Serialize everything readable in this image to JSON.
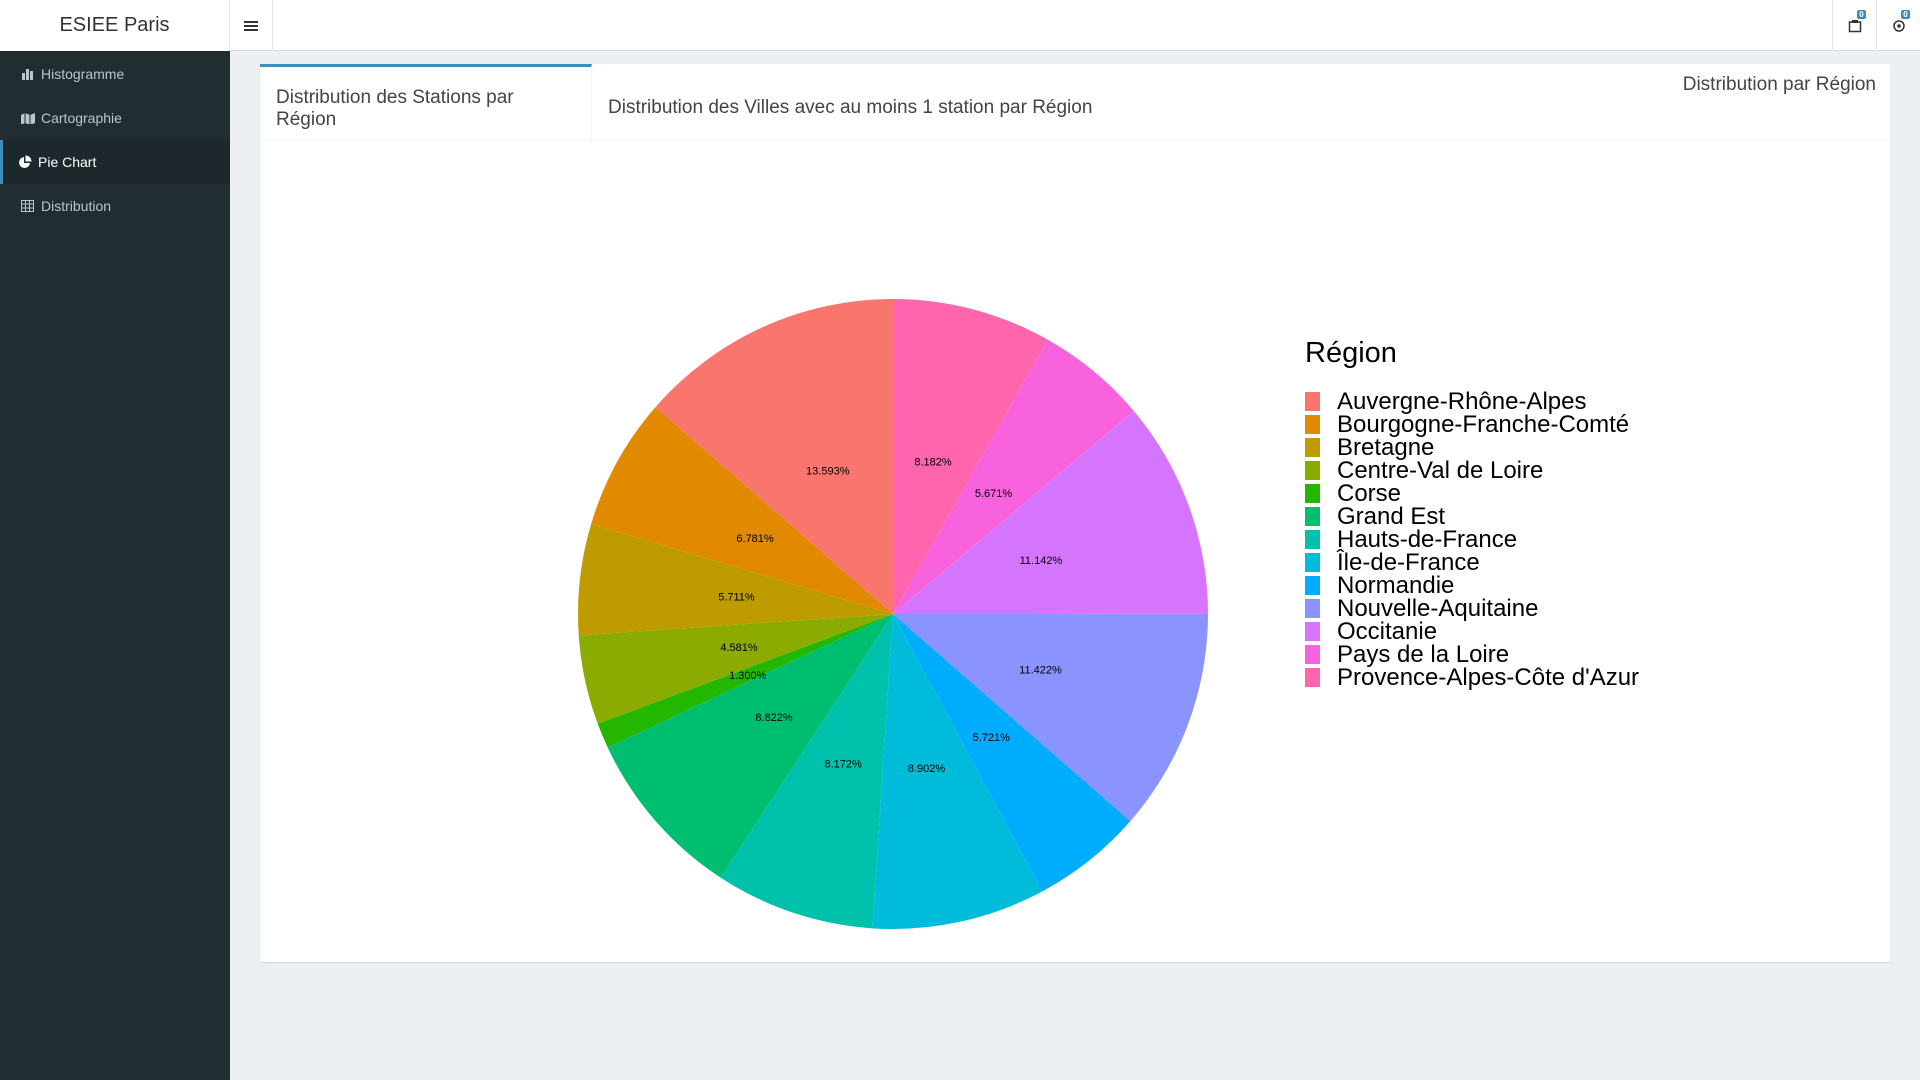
{
  "app": {
    "title": "ESIEE Paris"
  },
  "header": {
    "icons": [
      {
        "name": "tasks-icon",
        "badge": "0"
      },
      {
        "name": "gear-icon",
        "badge": "0"
      }
    ]
  },
  "sidebar": {
    "items": [
      {
        "label": "Histogramme",
        "icon": "bar-chart-icon",
        "active": false
      },
      {
        "label": "Cartographie",
        "icon": "map-icon",
        "active": false
      },
      {
        "label": "Pie Chart",
        "icon": "pie-chart-icon",
        "active": true
      },
      {
        "label": "Distribution",
        "icon": "table-icon",
        "active": false
      }
    ]
  },
  "main": {
    "box_title": "Distribution par Région",
    "tabs": [
      {
        "label": "Distribution des Stations par Région",
        "active": true
      },
      {
        "label": "Distribution des Villes avec au moins 1 station par Région",
        "active": false
      }
    ]
  },
  "chart_data": {
    "type": "pie",
    "legend_title": "Région",
    "legend_position": "right",
    "categories": [
      "Auvergne-Rhône-Alpes",
      "Bourgogne-Franche-Comté",
      "Bretagne",
      "Centre-Val de Loire",
      "Corse",
      "Grand Est",
      "Hauts-de-France",
      "Île-de-France",
      "Normandie",
      "Nouvelle-Aquitaine",
      "Occitanie",
      "Pays de la Loire",
      "Provence-Alpes-Côte d'Azur"
    ],
    "values": [
      13.593,
      6.781,
      5.711,
      4.581,
      1.3,
      8.822,
      8.172,
      8.902,
      5.721,
      11.422,
      11.142,
      5.671,
      8.182
    ],
    "labels": [
      "13.593%",
      "6.781%",
      "5.711%",
      "4.581%",
      "1.300%",
      "8.822%",
      "8.172%",
      "8.902%",
      "5.721%",
      "11.422%",
      "11.142%",
      "5.671%",
      "8.182%"
    ],
    "colors": [
      "#F8766D",
      "#E18A00",
      "#BE9C00",
      "#8CAB00",
      "#24B700",
      "#00BE70",
      "#00C1AB",
      "#00BBDA",
      "#00ACFC",
      "#8B93FF",
      "#D575FE",
      "#F962DD",
      "#FF65AC"
    ]
  }
}
